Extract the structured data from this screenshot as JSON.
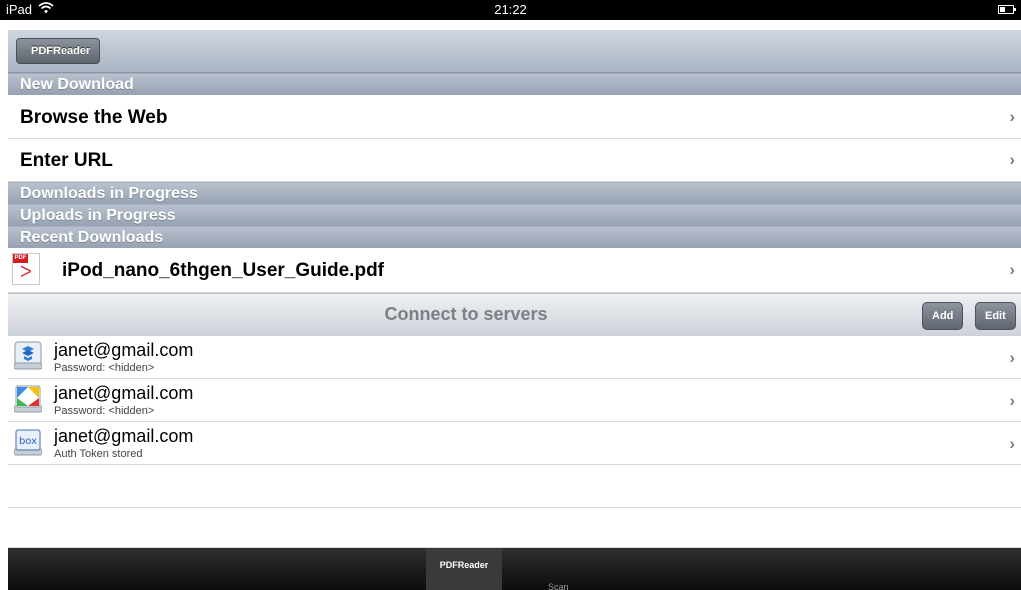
{
  "status_bar": {
    "carrier": "iPad",
    "time": "21:22"
  },
  "nav_bar": {
    "back_label": "PDFReader"
  },
  "sections": {
    "new_download": "New Download",
    "downloads_in_progress": "Downloads in Progress",
    "uploads_in_progress": "Uploads in Progress",
    "recent_downloads": "Recent Downloads"
  },
  "new_download_items": [
    {
      "label": "Browse the Web"
    },
    {
      "label": "Enter URL"
    }
  ],
  "recent_files": [
    {
      "name": "iPod_nano_6thgen_User_Guide.pdf",
      "icon": "pdf-file-icon",
      "icon_tag": "PDF"
    }
  ],
  "servers": {
    "title": "Connect to servers",
    "add_label": "Add",
    "edit_label": "Edit",
    "items": [
      {
        "account": "janet@gmail.com",
        "detail": "Password: <hidden>",
        "icon": "dropbox-icon"
      },
      {
        "account": "janet@gmail.com",
        "detail": "Password: <hidden>",
        "icon": "google-docs-icon"
      },
      {
        "account": "janet@gmail.com",
        "detail": "Auth Token stored",
        "icon": "box-icon",
        "icon_text": "box"
      }
    ]
  },
  "tab_bar": {
    "tabs": [
      {
        "label": "PDFReader",
        "selected": true
      },
      {
        "label": "Scan",
        "selected": false
      }
    ]
  },
  "colors": {
    "pdf_red": "#d71920",
    "section_header": "#a6b0bf",
    "tabbar": "#111111"
  }
}
